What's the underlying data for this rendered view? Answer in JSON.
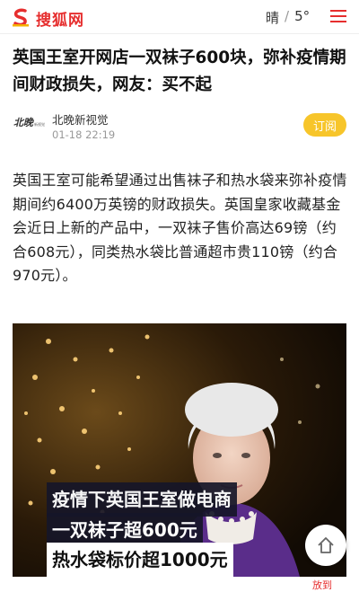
{
  "app": {
    "name": "搜狐网",
    "brand_color": "#e62e2e"
  },
  "weather": {
    "condition": "晴",
    "separator": "/",
    "temperature": "5°"
  },
  "article": {
    "title": "英国王室开网店一双袜子600块，弥补疫情期间财政损失，网友：买不起",
    "source": {
      "name": "北晚新视觉",
      "time": "01-18 22:19",
      "logo_text": "北晚新视觉"
    },
    "subscribe_label": "订阅",
    "subscribe_color": "#f7c52a",
    "body": "英国王室可能希望通过出售袜子和热水袋来弥补疫情期间约6400万英镑的财政损失。英国皇家收藏基金会近日上新的产品中，一双袜子售价高达69镑（约合608元），同类热水袋比普通超市贵110镑（约合970元）。"
  },
  "image": {
    "caption_line1": "疫情下英国王室做电商",
    "caption_line2": "一双袜子超600元",
    "caption_line3": "热水袋标价超1000元"
  },
  "floating": {
    "home_icon": "home-icon",
    "bottom_label": "放到"
  }
}
